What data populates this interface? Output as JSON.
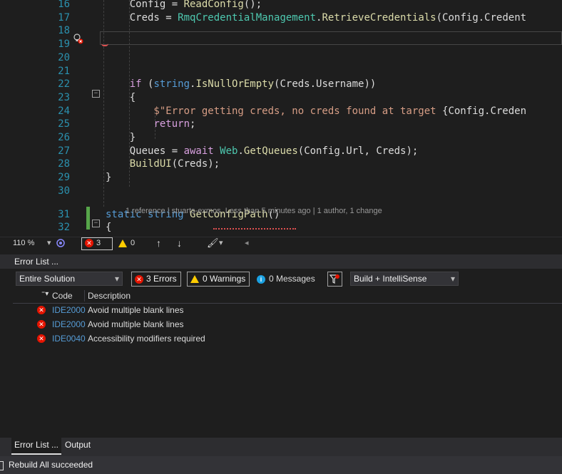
{
  "editor": {
    "lines": [
      {
        "num": "16",
        "tokens": [
          {
            "t": "    Config = ",
            "c": ""
          },
          {
            "t": "ReadConfig",
            "c": "fn"
          },
          {
            "t": "();",
            "c": ""
          }
        ]
      },
      {
        "num": "17",
        "tokens": [
          {
            "t": "    Creds = ",
            "c": ""
          },
          {
            "t": "RmqCredentialManagement",
            "c": "ty"
          },
          {
            "t": ".",
            "c": ""
          },
          {
            "t": "RetrieveCredentials",
            "c": "fn"
          },
          {
            "t": "(Config.Credent",
            "c": ""
          }
        ]
      },
      {
        "num": "18",
        "tokens": []
      },
      {
        "num": "19",
        "tokens": []
      },
      {
        "num": "20",
        "tokens": []
      },
      {
        "num": "21",
        "tokens": []
      },
      {
        "num": "22",
        "tokens": [
          {
            "t": "    ",
            "c": ""
          },
          {
            "t": "if",
            "c": "ctl"
          },
          {
            "t": " (",
            "c": ""
          },
          {
            "t": "string",
            "c": "kw"
          },
          {
            "t": ".",
            "c": ""
          },
          {
            "t": "IsNullOrEmpty",
            "c": "fn"
          },
          {
            "t": "(Creds.Username))",
            "c": ""
          }
        ]
      },
      {
        "num": "23",
        "tokens": [
          {
            "t": "    {",
            "c": ""
          }
        ]
      },
      {
        "num": "24",
        "tokens": [
          {
            "t": "        $\"Error getting creds, no creds found at target ",
            "c": "str"
          },
          {
            "t": "{Config.Creden",
            "c": ""
          }
        ]
      },
      {
        "num": "25",
        "tokens": [
          {
            "t": "        ",
            "c": ""
          },
          {
            "t": "return",
            "c": "ctl"
          },
          {
            "t": ";",
            "c": ""
          }
        ]
      },
      {
        "num": "26",
        "tokens": [
          {
            "t": "    }",
            "c": ""
          }
        ]
      },
      {
        "num": "27",
        "tokens": [
          {
            "t": "    Queues = ",
            "c": ""
          },
          {
            "t": "await",
            "c": "ctl"
          },
          {
            "t": " ",
            "c": ""
          },
          {
            "t": "Web",
            "c": "ty"
          },
          {
            "t": ".",
            "c": ""
          },
          {
            "t": "GetQueues",
            "c": "fn"
          },
          {
            "t": "(Config.Url, Creds);",
            "c": ""
          }
        ]
      },
      {
        "num": "28",
        "tokens": [
          {
            "t": "    ",
            "c": ""
          },
          {
            "t": "BuildUI",
            "c": "fn"
          },
          {
            "t": "(Creds);",
            "c": ""
          }
        ]
      },
      {
        "num": "29",
        "tokens": [
          {
            "t": "}",
            "c": ""
          }
        ]
      },
      {
        "num": "30",
        "tokens": []
      },
      {
        "num": "31",
        "tokens": [
          {
            "t": "static",
            "c": "kw"
          },
          {
            "t": " ",
            "c": ""
          },
          {
            "t": "string",
            "c": "kw"
          },
          {
            "t": " ",
            "c": ""
          },
          {
            "t": "GetConfigPath",
            "c": "fn"
          },
          {
            "t": "()",
            "c": ""
          }
        ]
      },
      {
        "num": "32",
        "tokens": [
          {
            "t": "{",
            "c": ""
          }
        ]
      }
    ],
    "codelens": "1 reference | stuarts-exmos, Less than 5 minutes ago | 1 author, 1 change",
    "zoom": "110 %",
    "error_count": "3",
    "warning_count": "0"
  },
  "error_list": {
    "title": "Error List ...",
    "scope_select": "Entire Solution",
    "errors_btn": "3 Errors",
    "warnings_btn": "0 Warnings",
    "messages_btn": "0 Messages",
    "source_select": "Build + IntelliSense",
    "columns": {
      "code": "Code",
      "description": "Description"
    },
    "rows": [
      {
        "code": "IDE2000",
        "description": "Avoid multiple blank lines"
      },
      {
        "code": "IDE2000",
        "description": "Avoid multiple blank lines"
      },
      {
        "code": "IDE0040",
        "description": "Accessibility modifiers required"
      }
    ]
  },
  "tabs": [
    "Error List ...",
    "Output"
  ],
  "status": "Rebuild All succeeded"
}
